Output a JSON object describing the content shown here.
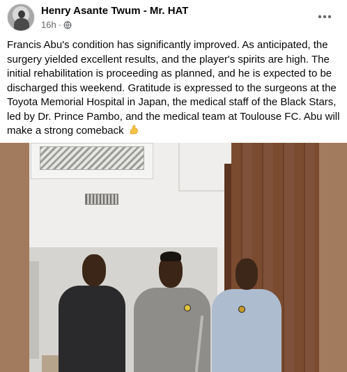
{
  "post": {
    "author": "Henry Asante Twum - Mr. HAT",
    "time": "16h",
    "separator": "·",
    "privacy_icon": "globe-icon",
    "more_icon": "more-horizontal-icon",
    "text": "Francis Abu's condition has significantly improved. As anticipated, the surgery yielded excellent results, and the player's spirits are high. The initial rehabilitation is proceeding as planned, and he is expected to be discharged this weekend. Gratitude is expressed to the surgeons at the Toyota Memorial Hospital in Japan, the medical staff of the Black Stars, led by Dr. Prince Pambo, and the medical team at Toulouse FC. Abu will make a strong comeback",
    "emoji": "flexed-biceps-emoji"
  },
  "colors": {
    "text": "#050505",
    "secondary": "#65676b",
    "photo_side": "#a27a5e"
  }
}
